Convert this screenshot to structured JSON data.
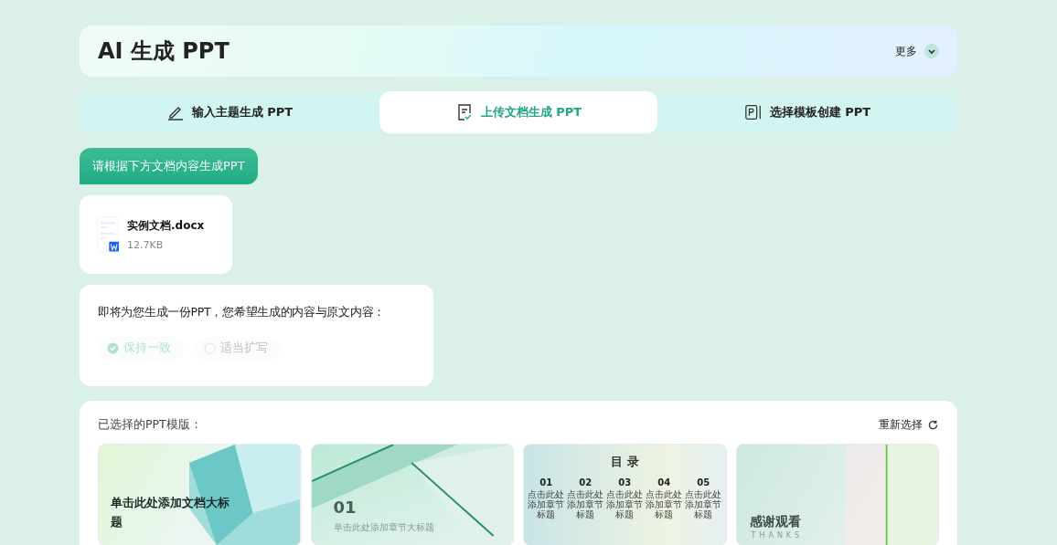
{
  "header": {
    "title": "AI 生成 PPT",
    "more": "更多"
  },
  "tabs": [
    {
      "label": "输入主题生成 PPT",
      "selected": false
    },
    {
      "label": "上传文档生成 PPT",
      "selected": true
    },
    {
      "label": "选择模板创建 PPT",
      "selected": false
    }
  ],
  "prompt_button": "请根据下方文档内容生成PPT",
  "file": {
    "name": "实例文档.docx",
    "size": "12.7KB"
  },
  "question": {
    "text": "即将为您生成一份PPT，您希望生成的内容与原文内容：",
    "options": [
      {
        "label": "保持一致",
        "selected": true,
        "disabled": true
      },
      {
        "label": "适当扩写",
        "selected": false,
        "disabled": true
      }
    ]
  },
  "templates": {
    "label": "已选择的PPT模版：",
    "reselect": "重新选择",
    "slides": [
      {
        "kind": "title",
        "title": "单击此处添加文档大标题"
      },
      {
        "kind": "section",
        "number": "01",
        "title": "单击此处添加章节大标题"
      },
      {
        "kind": "toc",
        "title": "目 录",
        "entries": [
          {
            "number": "01",
            "text": "点击此处添加章节标题"
          },
          {
            "number": "02",
            "text": "点击此处添加章节标题"
          },
          {
            "number": "03",
            "text": "点击此处添加章节标题"
          },
          {
            "number": "04",
            "text": "点击此处添加章节标题"
          },
          {
            "number": "05",
            "text": "点击此处添加章节标题"
          }
        ]
      },
      {
        "kind": "end",
        "title": "感谢观看",
        "subtitle": "THANKS"
      }
    ]
  }
}
